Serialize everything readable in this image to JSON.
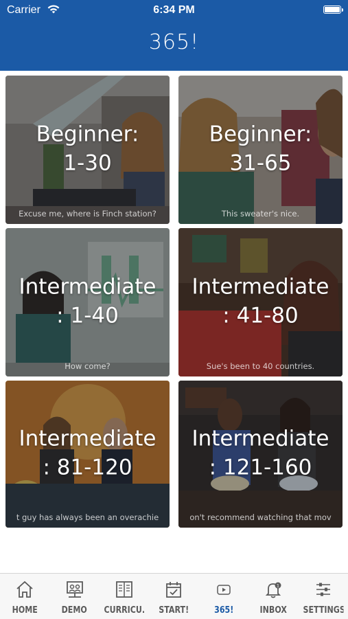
{
  "status_bar": {
    "carrier": "Carrier",
    "time": "6:34 PM"
  },
  "header": {
    "title": "365!"
  },
  "levels": [
    {
      "line1": "Beginner:",
      "line2": "1-30",
      "caption": "Excuse me, where is Finch station?"
    },
    {
      "line1": "Beginner:",
      "line2": "31-65",
      "caption": "This sweater's nice."
    },
    {
      "line1": "Intermediate",
      "line2": ": 1-40",
      "caption": "How come?"
    },
    {
      "line1": "Intermediate",
      "line2": ": 41-80",
      "caption": "Sue's been to 40 countries."
    },
    {
      "line1": "Intermediate",
      "line2": ": 81-120",
      "caption": "t guy has always been an overachie"
    },
    {
      "line1": "Intermediate",
      "line2": ": 121-160",
      "caption": "on't recommend watching that mov"
    }
  ],
  "tabs": [
    {
      "label": "HOME",
      "icon": "home-icon"
    },
    {
      "label": "DEMO",
      "icon": "demo-icon"
    },
    {
      "label": "CURRICU...",
      "icon": "book-icon"
    },
    {
      "label": "START!",
      "icon": "calendar-icon"
    },
    {
      "label": "365!",
      "icon": "play-icon",
      "active": true
    },
    {
      "label": "INBOX",
      "icon": "bell-icon"
    },
    {
      "label": "SETTINGS",
      "icon": "sliders-icon"
    }
  ],
  "colors": {
    "brand_blue": "#1b5aa6",
    "tab_inactive": "#5a5a5a"
  }
}
